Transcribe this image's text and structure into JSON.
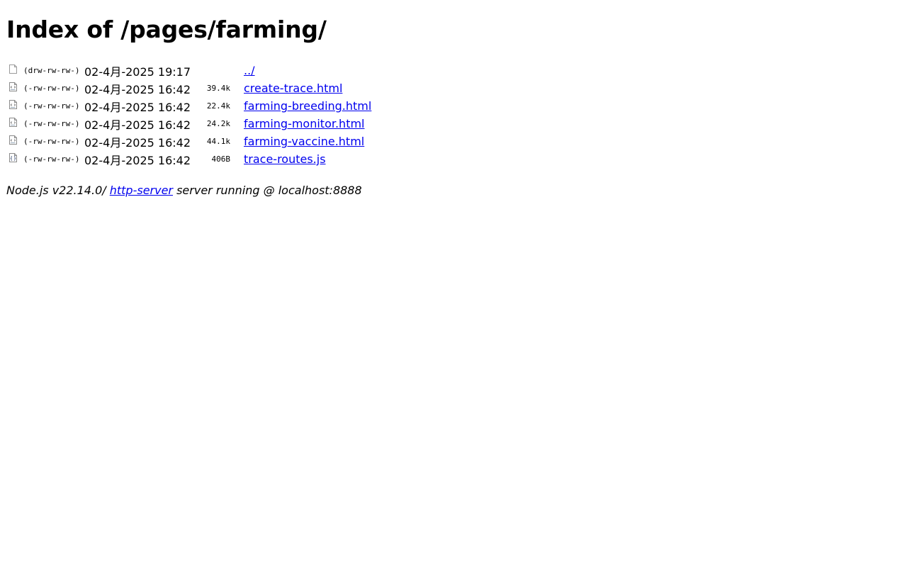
{
  "header": {
    "title": "Index of /pages/farming/"
  },
  "listing": [
    {
      "icon": "folder-icon",
      "perms": "(drw-rw-rw-)",
      "date": "02-4月-2025 19:17",
      "size": "",
      "name": "../"
    },
    {
      "icon": "html-file-icon",
      "perms": "(-rw-rw-rw-)",
      "date": "02-4月-2025 16:42",
      "size": "39.4k",
      "name": "create-trace.html"
    },
    {
      "icon": "html-file-icon",
      "perms": "(-rw-rw-rw-)",
      "date": "02-4月-2025 16:42",
      "size": "22.4k",
      "name": "farming-breeding.html"
    },
    {
      "icon": "html-file-icon",
      "perms": "(-rw-rw-rw-)",
      "date": "02-4月-2025 16:42",
      "size": "24.2k",
      "name": "farming-monitor.html"
    },
    {
      "icon": "html-file-icon",
      "perms": "(-rw-rw-rw-)",
      "date": "02-4月-2025 16:42",
      "size": "44.1k",
      "name": "farming-vaccine.html"
    },
    {
      "icon": "js-file-icon",
      "perms": "(-rw-rw-rw-)",
      "date": "02-4月-2025 16:42",
      "size": "406B",
      "name": "trace-routes.js"
    }
  ],
  "footer": {
    "prefix": "Node.js v22.14.0/ ",
    "link_text": "http-server",
    "suffix": " server running @ localhost:8888"
  },
  "colors": {
    "link": "#0000ee",
    "text": "#000000",
    "background": "#ffffff"
  }
}
